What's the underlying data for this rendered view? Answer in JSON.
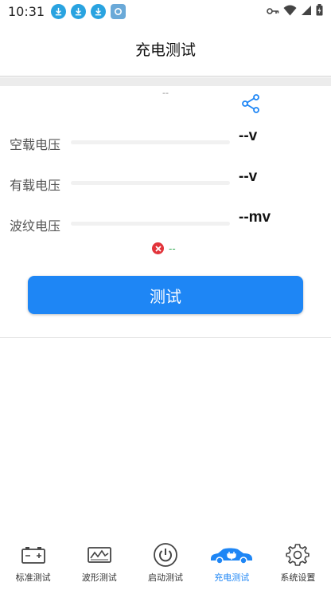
{
  "status_bar": {
    "time": "10:31",
    "notifications": [
      "download-icon",
      "download-icon",
      "download-icon",
      "app-icon"
    ]
  },
  "header": {
    "title": "充电测试"
  },
  "info": {
    "dash": "--"
  },
  "rows": [
    {
      "label": "空载电压",
      "value": "--v"
    },
    {
      "label": "有载电压",
      "value": "--v"
    },
    {
      "label": "波纹电压",
      "value": "--mv"
    }
  ],
  "status": {
    "text": "--"
  },
  "test_button": {
    "label": "测试"
  },
  "tabs": [
    {
      "label": "标准测试",
      "icon": "battery-icon",
      "active": false
    },
    {
      "label": "波形测试",
      "icon": "waveform-icon",
      "active": false
    },
    {
      "label": "启动测试",
      "icon": "power-icon",
      "active": false
    },
    {
      "label": "充电测试",
      "icon": "charging-car-icon",
      "active": true
    },
    {
      "label": "系统设置",
      "icon": "gear-icon",
      "active": false
    }
  ],
  "colors": {
    "accent": "#1e86f5",
    "error": "#e2343b",
    "status_text": "#2fa84f"
  }
}
